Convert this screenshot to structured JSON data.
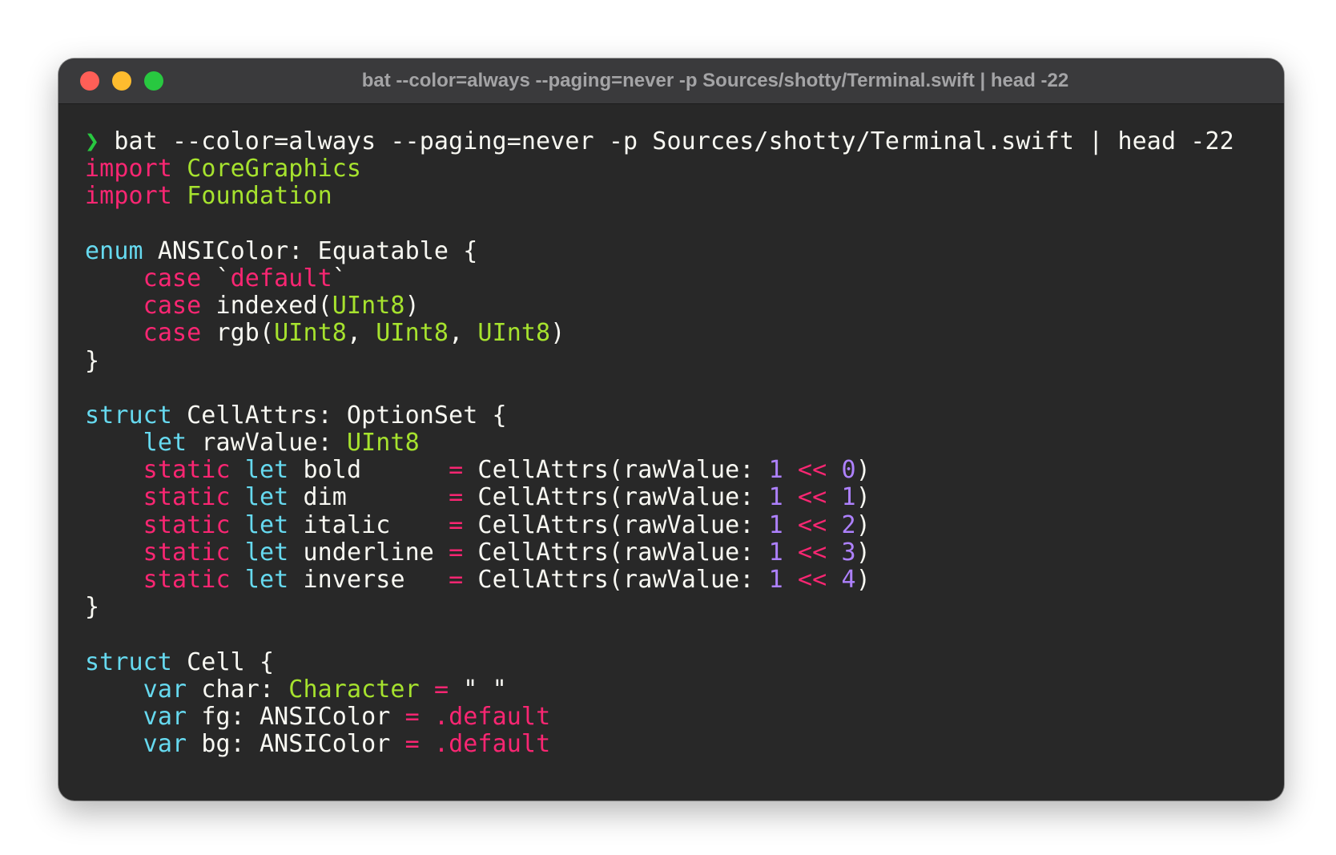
{
  "window": {
    "title": "bat --color=always --paging=never -p Sources/shotty/Terminal.swift | head -22",
    "colors": {
      "background": "#282828",
      "titlebar": "#3a3a3c",
      "close": "#ff5f57",
      "minimize": "#febc2e",
      "zoom": "#28c840"
    }
  },
  "terminal": {
    "colors": {
      "keyword": "#f92672",
      "keyword2": "#66d9ef",
      "type": "#a6e22e",
      "number": "#ae81ff",
      "plain": "#f8f8f2",
      "prompt": "#28c840"
    },
    "lines": [
      [
        {
          "t": "❯ ",
          "c": "prompt"
        },
        {
          "t": "bat --color=always --paging=never -p Sources/shotty/Terminal.swift | head -22",
          "c": "plain"
        }
      ],
      [
        {
          "t": "import",
          "c": "kw"
        },
        {
          "t": " ",
          "c": "plain"
        },
        {
          "t": "CoreGraphics",
          "c": "type"
        }
      ],
      [
        {
          "t": "import",
          "c": "kw"
        },
        {
          "t": " ",
          "c": "plain"
        },
        {
          "t": "Foundation",
          "c": "type"
        }
      ],
      [],
      [
        {
          "t": "enum",
          "c": "kw2"
        },
        {
          "t": " ANSIColor: Equatable {",
          "c": "plain"
        }
      ],
      [
        {
          "t": "    ",
          "c": "plain"
        },
        {
          "t": "case",
          "c": "kw"
        },
        {
          "t": " `",
          "c": "plain"
        },
        {
          "t": "default",
          "c": "kw"
        },
        {
          "t": "`",
          "c": "plain"
        }
      ],
      [
        {
          "t": "    ",
          "c": "plain"
        },
        {
          "t": "case",
          "c": "kw"
        },
        {
          "t": " indexed(",
          "c": "plain"
        },
        {
          "t": "UInt8",
          "c": "type"
        },
        {
          "t": ")",
          "c": "plain"
        }
      ],
      [
        {
          "t": "    ",
          "c": "plain"
        },
        {
          "t": "case",
          "c": "kw"
        },
        {
          "t": " rgb(",
          "c": "plain"
        },
        {
          "t": "UInt8",
          "c": "type"
        },
        {
          "t": ", ",
          "c": "plain"
        },
        {
          "t": "UInt8",
          "c": "type"
        },
        {
          "t": ", ",
          "c": "plain"
        },
        {
          "t": "UInt8",
          "c": "type"
        },
        {
          "t": ")",
          "c": "plain"
        }
      ],
      [
        {
          "t": "}",
          "c": "plain"
        }
      ],
      [],
      [
        {
          "t": "struct",
          "c": "kw2"
        },
        {
          "t": " CellAttrs: OptionSet {",
          "c": "plain"
        }
      ],
      [
        {
          "t": "    ",
          "c": "plain"
        },
        {
          "t": "let",
          "c": "kw2"
        },
        {
          "t": " rawValue: ",
          "c": "plain"
        },
        {
          "t": "UInt8",
          "c": "type"
        }
      ],
      [
        {
          "t": "    ",
          "c": "plain"
        },
        {
          "t": "static",
          "c": "kw"
        },
        {
          "t": " ",
          "c": "plain"
        },
        {
          "t": "let",
          "c": "kw2"
        },
        {
          "t": " bold      ",
          "c": "plain"
        },
        {
          "t": "=",
          "c": "kw"
        },
        {
          "t": " CellAttrs(rawValue: ",
          "c": "plain"
        },
        {
          "t": "1",
          "c": "num"
        },
        {
          "t": " ",
          "c": "plain"
        },
        {
          "t": "<<",
          "c": "kw"
        },
        {
          "t": " ",
          "c": "plain"
        },
        {
          "t": "0",
          "c": "num"
        },
        {
          "t": ")",
          "c": "plain"
        }
      ],
      [
        {
          "t": "    ",
          "c": "plain"
        },
        {
          "t": "static",
          "c": "kw"
        },
        {
          "t": " ",
          "c": "plain"
        },
        {
          "t": "let",
          "c": "kw2"
        },
        {
          "t": " dim       ",
          "c": "plain"
        },
        {
          "t": "=",
          "c": "kw"
        },
        {
          "t": " CellAttrs(rawValue: ",
          "c": "plain"
        },
        {
          "t": "1",
          "c": "num"
        },
        {
          "t": " ",
          "c": "plain"
        },
        {
          "t": "<<",
          "c": "kw"
        },
        {
          "t": " ",
          "c": "plain"
        },
        {
          "t": "1",
          "c": "num"
        },
        {
          "t": ")",
          "c": "plain"
        }
      ],
      [
        {
          "t": "    ",
          "c": "plain"
        },
        {
          "t": "static",
          "c": "kw"
        },
        {
          "t": " ",
          "c": "plain"
        },
        {
          "t": "let",
          "c": "kw2"
        },
        {
          "t": " italic    ",
          "c": "plain"
        },
        {
          "t": "=",
          "c": "kw"
        },
        {
          "t": " CellAttrs(rawValue: ",
          "c": "plain"
        },
        {
          "t": "1",
          "c": "num"
        },
        {
          "t": " ",
          "c": "plain"
        },
        {
          "t": "<<",
          "c": "kw"
        },
        {
          "t": " ",
          "c": "plain"
        },
        {
          "t": "2",
          "c": "num"
        },
        {
          "t": ")",
          "c": "plain"
        }
      ],
      [
        {
          "t": "    ",
          "c": "plain"
        },
        {
          "t": "static",
          "c": "kw"
        },
        {
          "t": " ",
          "c": "plain"
        },
        {
          "t": "let",
          "c": "kw2"
        },
        {
          "t": " underline ",
          "c": "plain"
        },
        {
          "t": "=",
          "c": "kw"
        },
        {
          "t": " CellAttrs(rawValue: ",
          "c": "plain"
        },
        {
          "t": "1",
          "c": "num"
        },
        {
          "t": " ",
          "c": "plain"
        },
        {
          "t": "<<",
          "c": "kw"
        },
        {
          "t": " ",
          "c": "plain"
        },
        {
          "t": "3",
          "c": "num"
        },
        {
          "t": ")",
          "c": "plain"
        }
      ],
      [
        {
          "t": "    ",
          "c": "plain"
        },
        {
          "t": "static",
          "c": "kw"
        },
        {
          "t": " ",
          "c": "plain"
        },
        {
          "t": "let",
          "c": "kw2"
        },
        {
          "t": " inverse   ",
          "c": "plain"
        },
        {
          "t": "=",
          "c": "kw"
        },
        {
          "t": " CellAttrs(rawValue: ",
          "c": "plain"
        },
        {
          "t": "1",
          "c": "num"
        },
        {
          "t": " ",
          "c": "plain"
        },
        {
          "t": "<<",
          "c": "kw"
        },
        {
          "t": " ",
          "c": "plain"
        },
        {
          "t": "4",
          "c": "num"
        },
        {
          "t": ")",
          "c": "plain"
        }
      ],
      [
        {
          "t": "}",
          "c": "plain"
        }
      ],
      [],
      [
        {
          "t": "struct",
          "c": "kw2"
        },
        {
          "t": " Cell {",
          "c": "plain"
        }
      ],
      [
        {
          "t": "    ",
          "c": "plain"
        },
        {
          "t": "var",
          "c": "kw2"
        },
        {
          "t": " char: ",
          "c": "plain"
        },
        {
          "t": "Character",
          "c": "type"
        },
        {
          "t": " ",
          "c": "plain"
        },
        {
          "t": "=",
          "c": "kw"
        },
        {
          "t": " \" \"",
          "c": "plain"
        }
      ],
      [
        {
          "t": "    ",
          "c": "plain"
        },
        {
          "t": "var",
          "c": "kw2"
        },
        {
          "t": " fg: ANSIColor ",
          "c": "plain"
        },
        {
          "t": "=",
          "c": "kw"
        },
        {
          "t": " ",
          "c": "plain"
        },
        {
          "t": ".default",
          "c": "kw"
        }
      ],
      [
        {
          "t": "    ",
          "c": "plain"
        },
        {
          "t": "var",
          "c": "kw2"
        },
        {
          "t": " bg: ANSIColor ",
          "c": "plain"
        },
        {
          "t": "=",
          "c": "kw"
        },
        {
          "t": " ",
          "c": "plain"
        },
        {
          "t": ".default",
          "c": "kw"
        }
      ]
    ]
  }
}
